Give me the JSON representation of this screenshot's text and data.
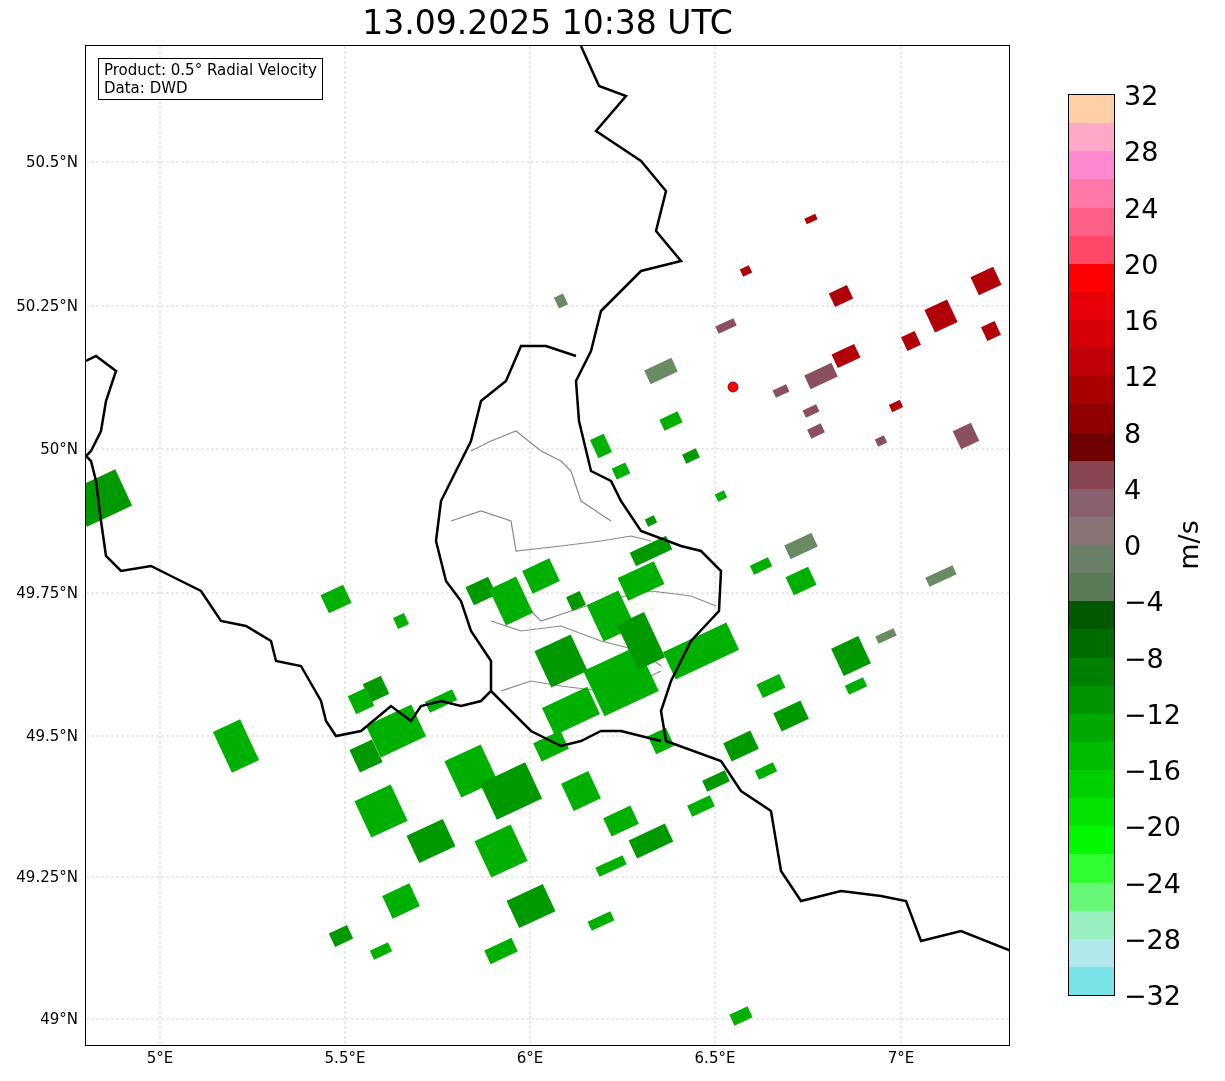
{
  "title": "13.09.2025 10:38 UTC",
  "info_box": [
    "Product: 0.5° Radial Velocity",
    "Data: DWD"
  ],
  "map": {
    "yticks": [
      "50.5°N",
      "50.25°N",
      "50°N",
      "49.75°N",
      "49.5°N",
      "49.25°N",
      "49°N"
    ],
    "xticks": [
      "5°E",
      "5.5°E",
      "6°E",
      "6.5°E",
      "7°E"
    ]
  },
  "colorbar": {
    "unit": "m/s",
    "ticks": [
      "32",
      "28",
      "24",
      "20",
      "16",
      "12",
      "8",
      "4",
      "0",
      "−4",
      "−8",
      "−12",
      "−16",
      "−20",
      "−24",
      "−28",
      "−32"
    ],
    "bands": [
      {
        "color": "#ffcfa8"
      },
      {
        "color": "#ffa8c8"
      },
      {
        "color": "#ff88d0"
      },
      {
        "color": "#ff78a8"
      },
      {
        "color": "#ff6088"
      },
      {
        "color": "#ff4868"
      },
      {
        "color": "#ff0000"
      },
      {
        "color": "#e80008"
      },
      {
        "color": "#d80008"
      },
      {
        "color": "#c00008"
      },
      {
        "color": "#a80000"
      },
      {
        "color": "#900000"
      },
      {
        "color": "#700000"
      },
      {
        "color": "#884450"
      },
      {
        "color": "#886070"
      },
      {
        "color": "#887474"
      },
      {
        "color": "#6a8068"
      },
      {
        "color": "#5a7a58"
      },
      {
        "color": "#005800"
      },
      {
        "color": "#006c00"
      },
      {
        "color": "#008000"
      },
      {
        "color": "#009400"
      },
      {
        "color": "#00a800"
      },
      {
        "color": "#00bc00"
      },
      {
        "color": "#00d000"
      },
      {
        "color": "#00e400"
      },
      {
        "color": "#00f800"
      },
      {
        "color": "#30ff30"
      },
      {
        "color": "#68f878"
      },
      {
        "color": "#98f0c0"
      },
      {
        "color": "#b0e8ec"
      },
      {
        "color": "#78e4e8"
      }
    ]
  }
}
